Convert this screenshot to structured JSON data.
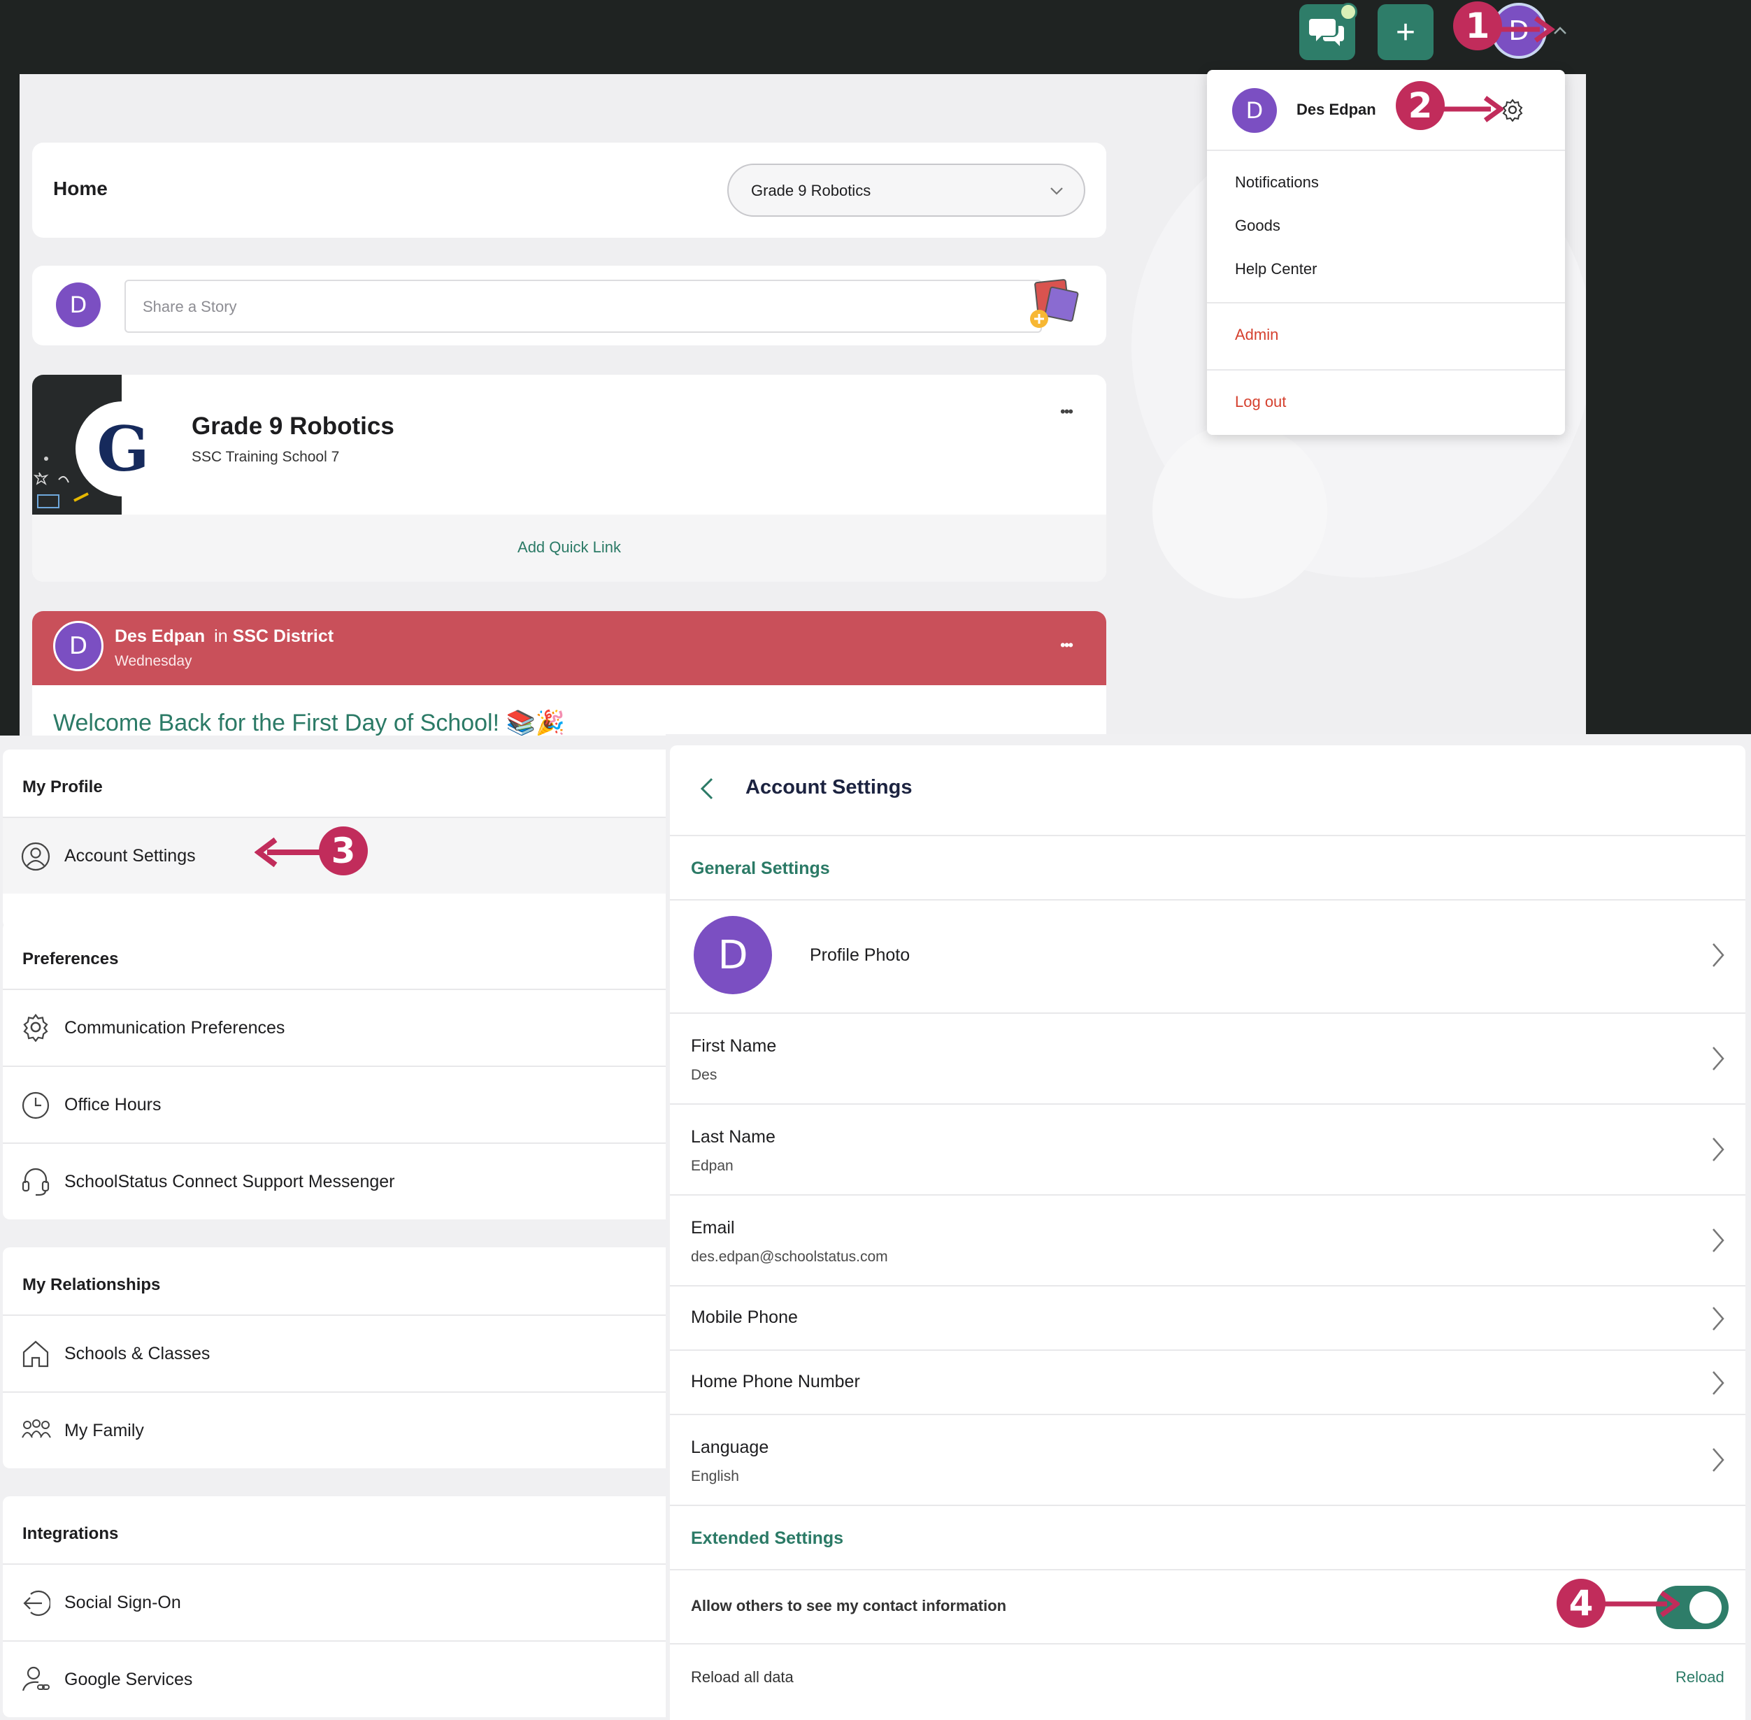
{
  "topbar": {
    "profile_initial": "D",
    "plus_label": "+"
  },
  "home": {
    "title": "Home",
    "class_select": "Grade 9 Robotics",
    "share_placeholder": "Share a Story",
    "user_initial": "D"
  },
  "class_card": {
    "logo_letter": "G",
    "name": "Grade 9 Robotics",
    "school": "SSC Training School 7",
    "more": "•••",
    "quick_link": "Add Quick Link"
  },
  "post": {
    "author_initial": "D",
    "author": "Des Edpan",
    "in_text": "in",
    "district": "SSC District",
    "day": "Wednesday",
    "more": "•••",
    "headline": "Welcome Back for the First Day of School! 📚🎉"
  },
  "dropdown": {
    "user_initial": "D",
    "user_name": "Des Edpan",
    "items": [
      "Notifications",
      "Goods",
      "Help Center"
    ],
    "admin": "Admin",
    "logout": "Log out"
  },
  "callouts": [
    "1",
    "2",
    "3",
    "4"
  ],
  "sidebar": {
    "my_profile": "My Profile",
    "account_settings": "Account Settings",
    "preferences": "Preferences",
    "pref_items": [
      "Communication Preferences",
      "Office Hours",
      "SchoolStatus Connect Support Messenger"
    ],
    "relationships": "My Relationships",
    "rel_items": [
      "Schools & Classes",
      "My Family"
    ],
    "integrations": "Integrations",
    "int_items": [
      "Social Sign-On",
      "Google Services"
    ]
  },
  "account": {
    "title": "Account Settings",
    "general": "General Settings",
    "photo_initial": "D",
    "profile_photo": "Profile Photo",
    "first_name_label": "First Name",
    "first_name": "Des",
    "last_name_label": "Last Name",
    "last_name": "Edpan",
    "email_label": "Email",
    "email": "des.edpan@schoolstatus.com",
    "mobile_label": "Mobile Phone",
    "home_phone_label": "Home Phone Number",
    "language_label": "Language",
    "language": "English",
    "extended": "Extended Settings",
    "contact_toggle_label": "Allow others to see my contact information",
    "contact_toggle_on": true,
    "reload_label": "Reload all data",
    "reload_action": "Reload"
  },
  "colors": {
    "brand_green": "#2b7a66",
    "avatar_purple": "#7b4fc2",
    "callout_magenta": "#c12c5b",
    "post_red": "#c9505a",
    "admin_red": "#d5412f"
  }
}
